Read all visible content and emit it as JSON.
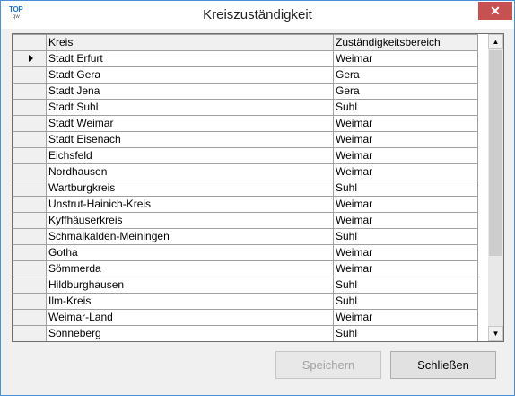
{
  "window": {
    "title": "Kreiszuständigkeit",
    "logo_top": "TOP",
    "logo_bottom": "qw",
    "close_symbol": "✕"
  },
  "grid": {
    "columns": [
      "Kreis",
      "Zuständigkeitsbereich"
    ],
    "rows": [
      [
        "Stadt Erfurt",
        "Weimar"
      ],
      [
        "Stadt Gera",
        "Gera"
      ],
      [
        "Stadt Jena",
        "Gera"
      ],
      [
        "Stadt Suhl",
        "Suhl"
      ],
      [
        "Stadt Weimar",
        "Weimar"
      ],
      [
        "Stadt Eisenach",
        "Weimar"
      ],
      [
        "Eichsfeld",
        "Weimar"
      ],
      [
        "Nordhausen",
        "Weimar"
      ],
      [
        "Wartburgkreis",
        "Suhl"
      ],
      [
        "Unstrut-Hainich-Kreis",
        "Weimar"
      ],
      [
        "Kyffhäuserkreis",
        "Weimar"
      ],
      [
        "Schmalkalden-Meiningen",
        "Suhl"
      ],
      [
        "Gotha",
        "Weimar"
      ],
      [
        "Sömmerda",
        "Weimar"
      ],
      [
        "Hildburghausen",
        "Suhl"
      ],
      [
        "Ilm-Kreis",
        "Suhl"
      ],
      [
        "Weimar-Land",
        "Weimar"
      ],
      [
        "Sonneberg",
        "Suhl"
      ]
    ],
    "current_row": 0
  },
  "buttons": {
    "save": "Speichern",
    "close": "Schließen"
  }
}
